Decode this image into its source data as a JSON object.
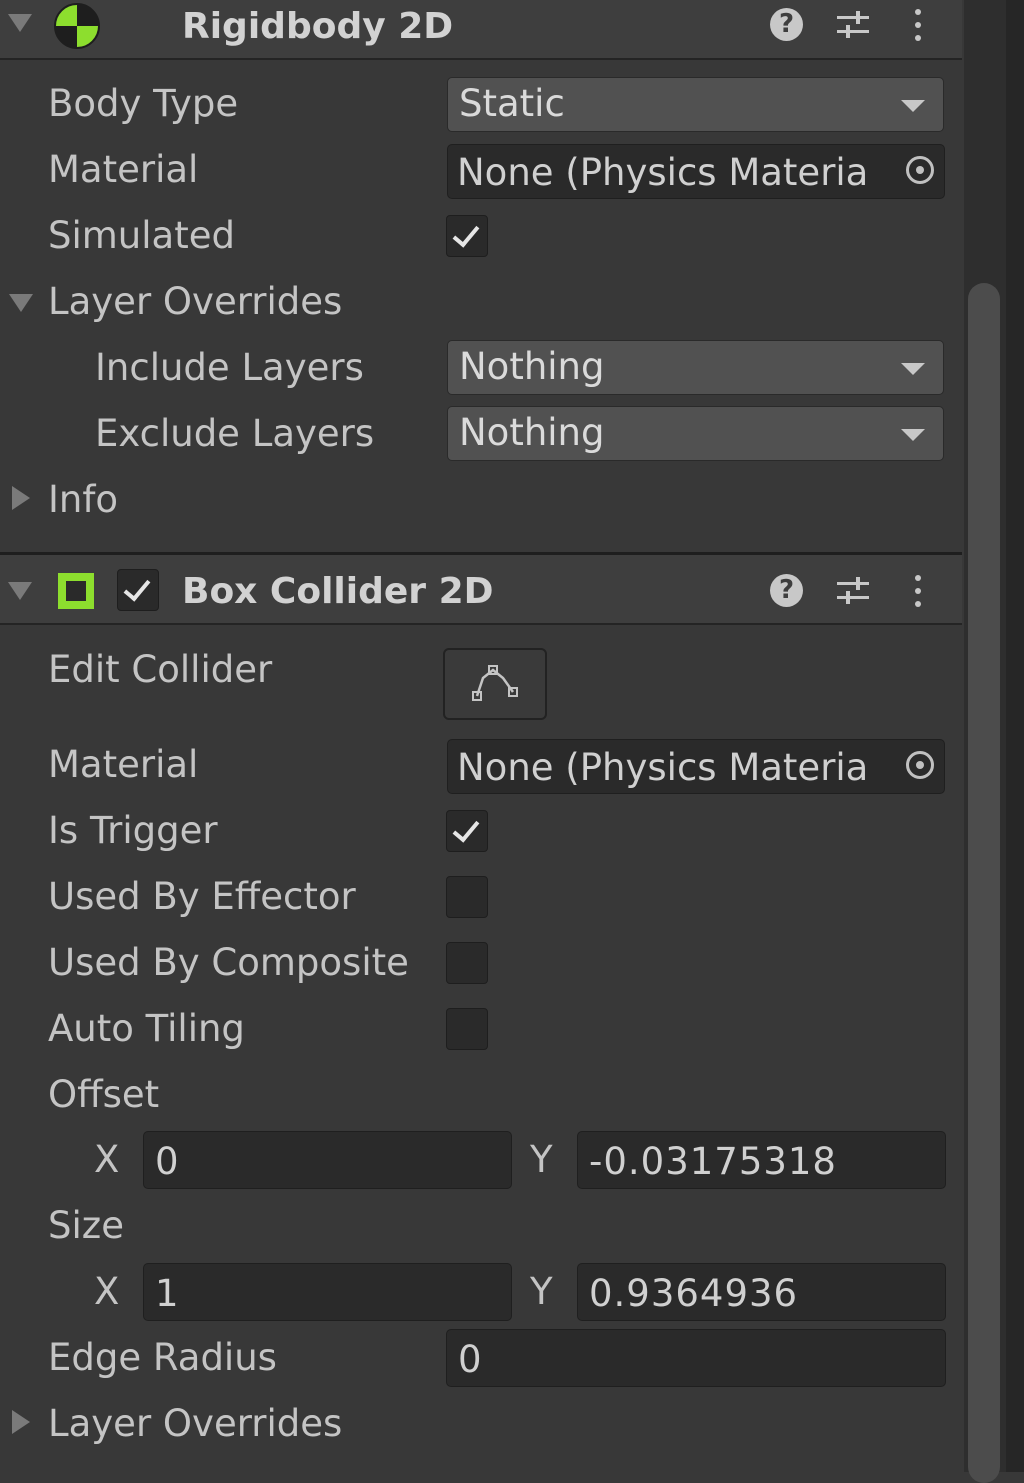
{
  "rigidbody": {
    "title": "Rigidbody 2D",
    "fields": {
      "body_type_label": "Body Type",
      "body_type_value": "Static",
      "material_label": "Material",
      "material_value": "None (Physics Materia",
      "simulated_label": "Simulated",
      "simulated_checked": true,
      "layer_overrides_label": "Layer Overrides",
      "include_layers_label": "Include Layers",
      "include_layers_value": "Nothing",
      "exclude_layers_label": "Exclude Layers",
      "exclude_layers_value": "Nothing",
      "info_label": "Info"
    }
  },
  "box_collider": {
    "title": "Box Collider 2D",
    "enabled": true,
    "fields": {
      "edit_collider_label": "Edit Collider",
      "material_label": "Material",
      "material_value": "None (Physics Materia",
      "is_trigger_label": "Is Trigger",
      "is_trigger_checked": true,
      "used_by_effector_label": "Used By Effector",
      "used_by_effector_checked": false,
      "used_by_composite_label": "Used By Composite",
      "used_by_composite_checked": false,
      "auto_tiling_label": "Auto Tiling",
      "auto_tiling_checked": false,
      "offset_label": "Offset",
      "offset_x_label": "X",
      "offset_x_value": "0",
      "offset_y_label": "Y",
      "offset_y_value": "-0.03175318",
      "size_label": "Size",
      "size_x_label": "X",
      "size_x_value": "1",
      "size_y_label": "Y",
      "size_y_value": "0.9364936",
      "edge_radius_label": "Edge Radius",
      "edge_radius_value": "0",
      "layer_overrides_label": "Layer Overrides"
    }
  },
  "icons": {
    "rigidbody_icon": "rigidbody-icon",
    "box_collider_icon": "box-collider-icon",
    "help_icon": "help-icon",
    "presets_icon": "presets-icon",
    "menu_icon": "kebab-menu-icon",
    "edit_collider_icon": "edit-collider-icon",
    "object_picker_icon": "object-picker-icon"
  },
  "colors": {
    "background": "#383838",
    "header": "#3e3e3e",
    "field_dark": "#2a2a2a",
    "dropdown": "#515151",
    "accent_green": "#8dde2e",
    "text": "#c4c4c4"
  }
}
